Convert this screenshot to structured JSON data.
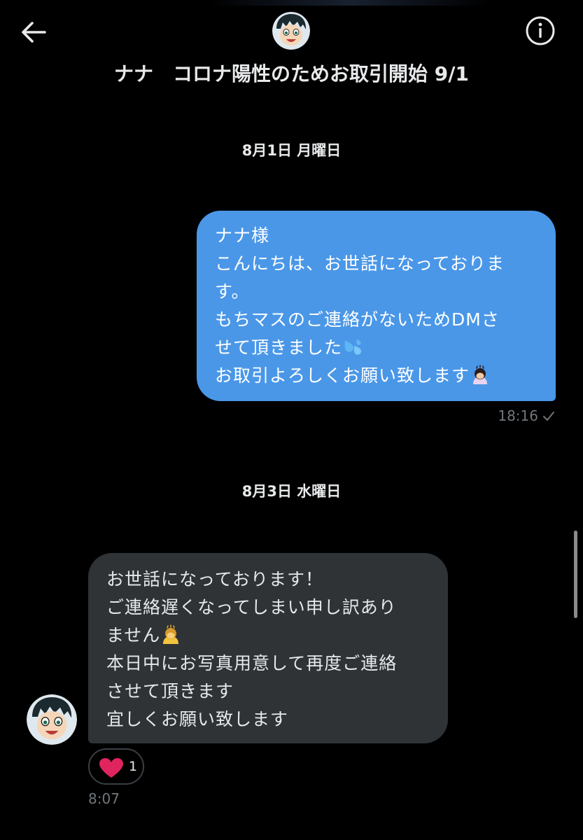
{
  "header": {
    "title": "ナナ　コロナ陽性のためお取引開始 9/1"
  },
  "conversation": {
    "dates": [
      "8月1日 月曜日",
      "8月3日 水曜日"
    ],
    "outgoing": {
      "lines": [
        "ナナ様",
        "こんにちは、お世話になっておりま",
        "す。",
        "もちマスのご連絡がないためDMさ",
        "せて頂きました",
        "お取引よろしくお願い致します"
      ],
      "time": "18:16"
    },
    "incoming": {
      "lines": [
        "お世話になっております！",
        "ご連絡遅くなってしまい申し訳あり",
        "ません",
        "本日中にお写真用意して再度ご連絡",
        "させて頂きます",
        "宜しくお願い致します"
      ],
      "time": "8:07",
      "reaction_count": "1"
    }
  },
  "icons": {
    "back": "arrow-left-icon",
    "info": "info-icon",
    "sweat": "sweat-droplets-emoji",
    "bow": "bowing-person-emoji",
    "heart": "heart-icon",
    "read": "checkmark-icon"
  },
  "colors": {
    "background": "#000000",
    "outgoing_bubble": "#4a97e8",
    "incoming_bubble": "#2f3336",
    "muted_text": "#71767b",
    "heart": "#e0245e"
  }
}
